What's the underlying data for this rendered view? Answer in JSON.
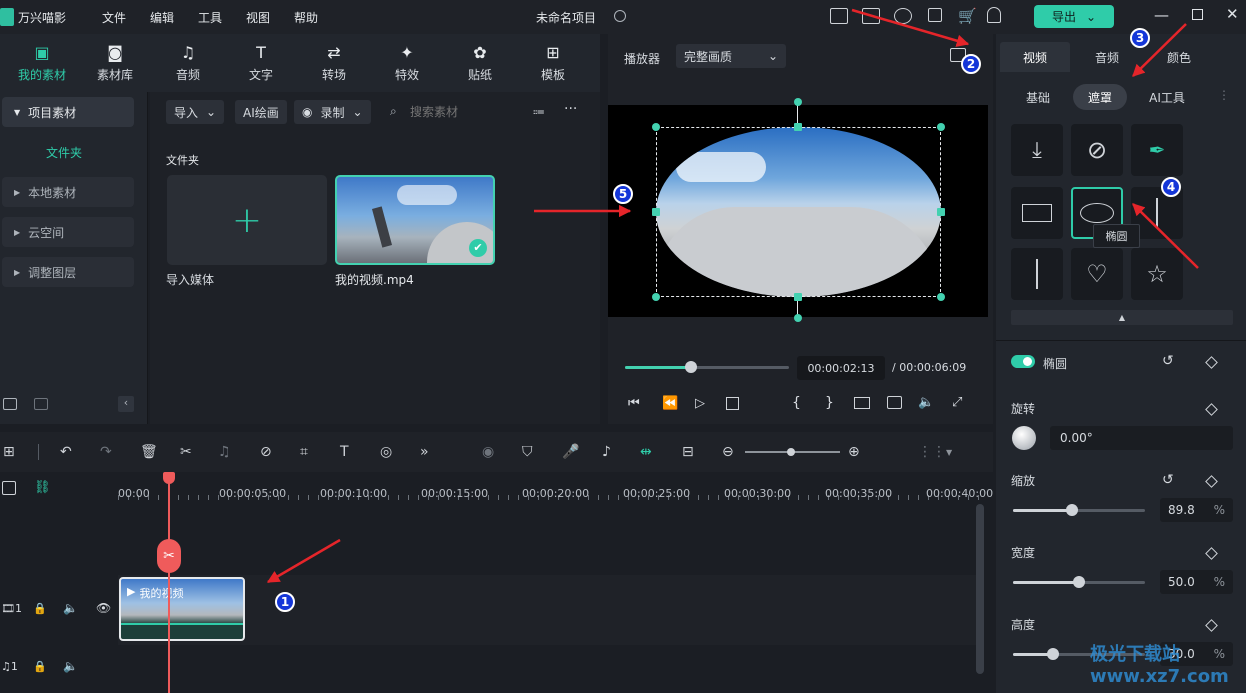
{
  "app": {
    "name": "万兴喵影",
    "project_title": "未命名项目",
    "export_label": "导出"
  },
  "menu": [
    "文件",
    "编辑",
    "工具",
    "视图",
    "帮助"
  ],
  "toolbar": [
    {
      "label": "我的素材",
      "icon": "media-icon"
    },
    {
      "label": "素材库",
      "icon": "library-icon"
    },
    {
      "label": "音频",
      "icon": "music-icon"
    },
    {
      "label": "文字",
      "icon": "text-icon"
    },
    {
      "label": "转场",
      "icon": "transition-icon"
    },
    {
      "label": "特效",
      "icon": "effects-icon"
    },
    {
      "label": "贴纸",
      "icon": "sticker-icon"
    },
    {
      "label": "模板",
      "icon": "template-icon"
    }
  ],
  "left_nav": {
    "project_media": "项目素材",
    "folder": "文件夹",
    "items": [
      "本地素材",
      "云空间",
      "调整图层"
    ]
  },
  "media_toolbar": {
    "import": "导入",
    "ai_draw": "AI绘画",
    "record": "录制",
    "search_placeholder": "搜索素材"
  },
  "media": {
    "section": "文件夹",
    "import_label": "导入媒体",
    "clip_label": "我的视频.mp4"
  },
  "player": {
    "label": "播放器",
    "quality": "完整画质",
    "current_time": "00:00:02:13",
    "total_time": "/  00:00:06:09",
    "progress": 0.4
  },
  "right_panel": {
    "tabs": [
      "视频",
      "音频",
      "颜色"
    ],
    "subtabs": [
      "基础",
      "遮罩",
      "AI工具"
    ],
    "tooltip": "椭圆",
    "mask_name": "椭圆",
    "rotation": {
      "label": "旋转",
      "value": "0.00°"
    },
    "scale": {
      "label": "缩放",
      "value": "89.8",
      "unit": "%",
      "level": 0.45
    },
    "width": {
      "label": "宽度",
      "value": "50.0",
      "unit": "%",
      "level": 0.5
    },
    "height": {
      "label": "高度",
      "value": "30.0",
      "unit": "%",
      "level": 0.3
    }
  },
  "timeline": {
    "ticks": [
      "00:00",
      "00:00:05:00",
      "00:00:10:00",
      "00:00:15:00",
      "00:00:20:00",
      "00:00:25:00",
      "00:00:30:00",
      "00:00:35:00",
      "00:00:40:00"
    ],
    "clip_label": "我的视频",
    "track1": "1",
    "track2": "1"
  },
  "annotations": [
    "1",
    "2",
    "3",
    "4",
    "5"
  ],
  "watermark": "极光下载站 www.xz7.com",
  "colors": {
    "accent": "#2fcca9",
    "arrow": "#e5252a",
    "badge": "#1436d8"
  }
}
